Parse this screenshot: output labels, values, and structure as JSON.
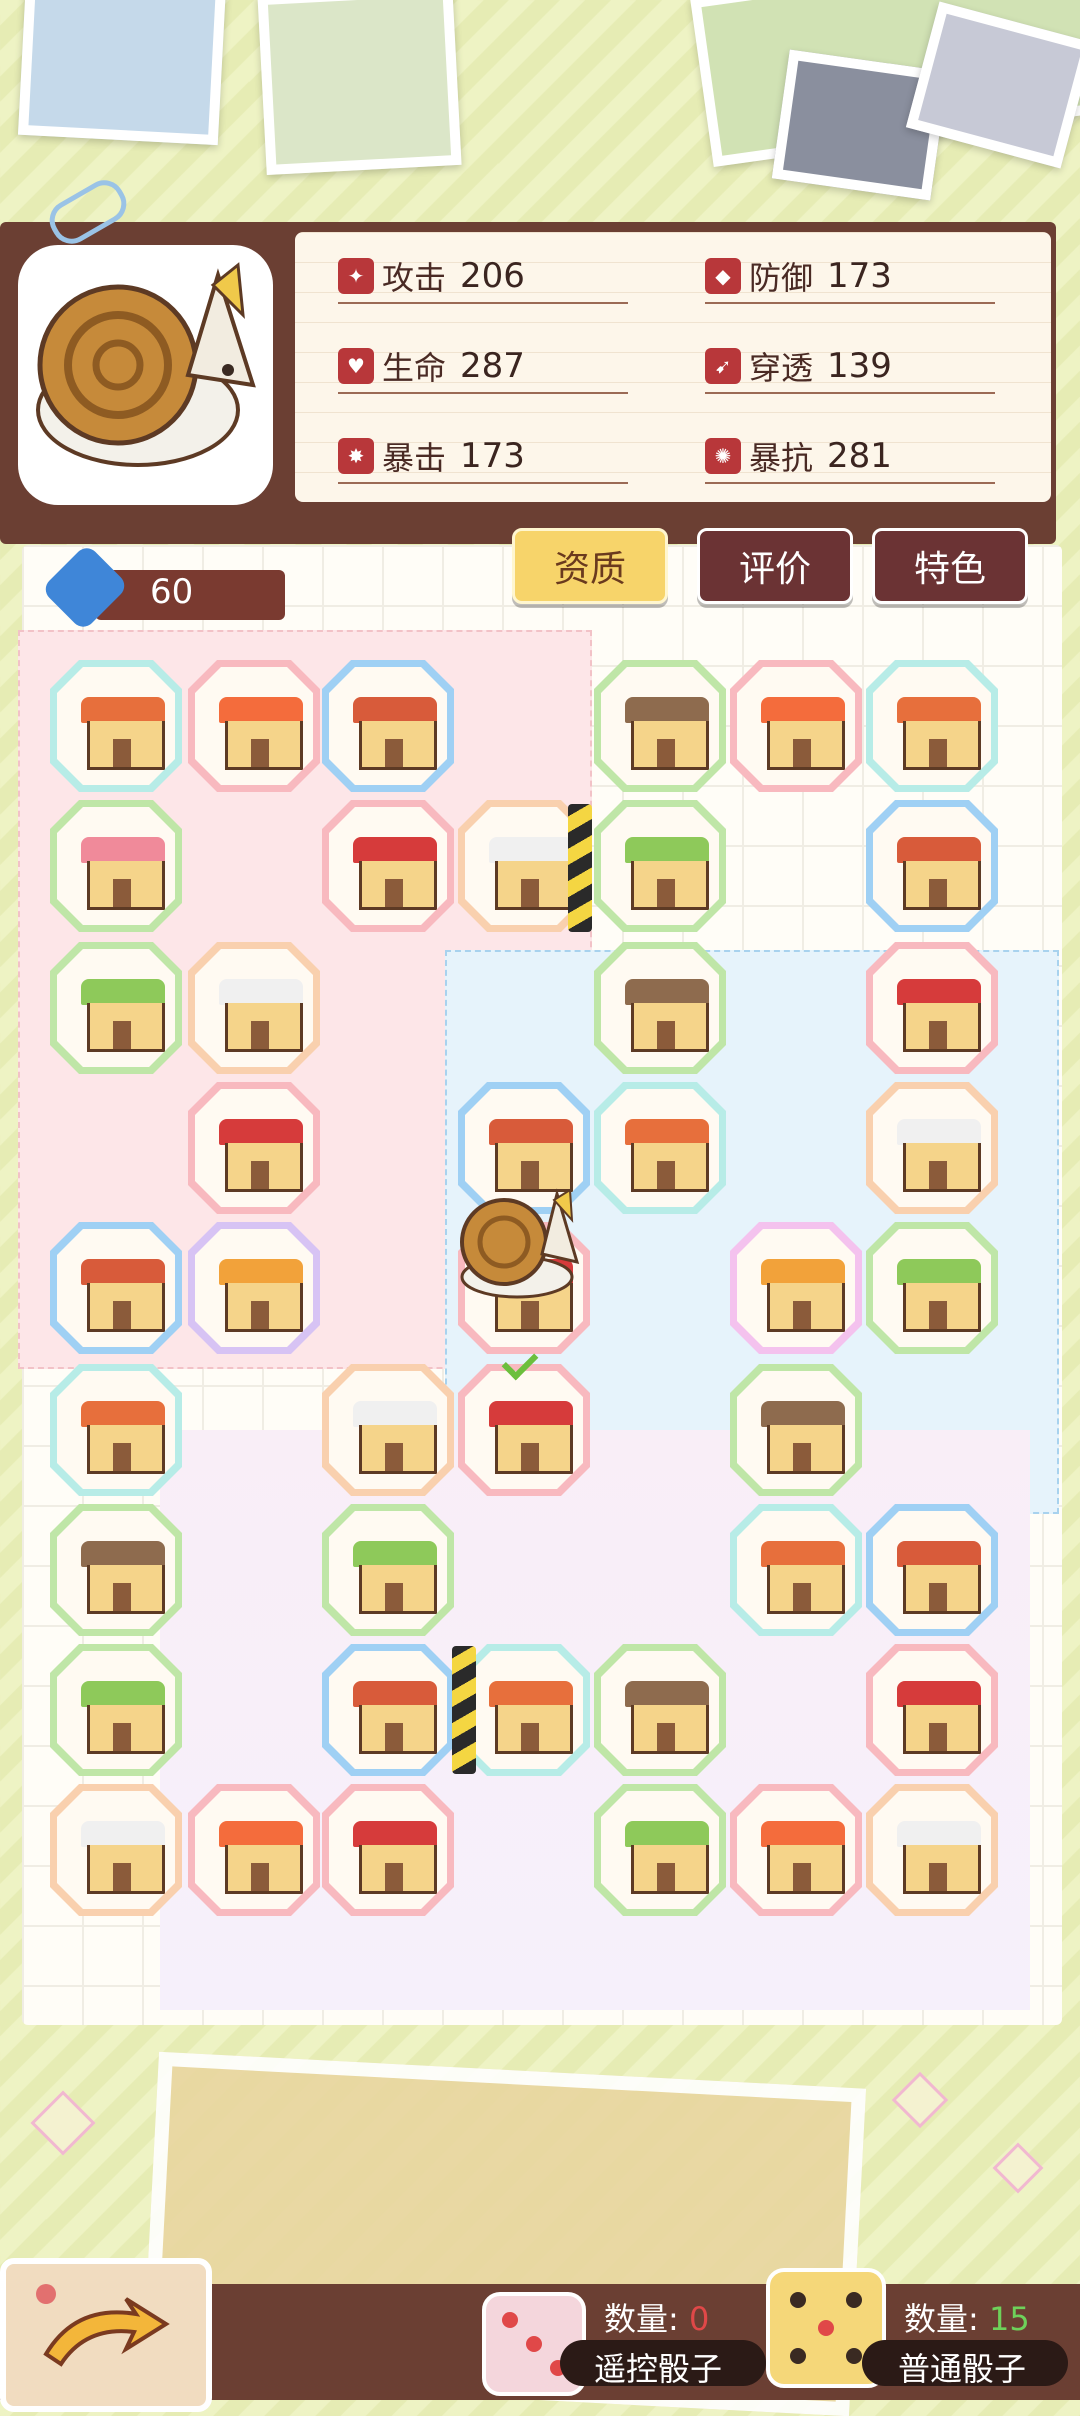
{
  "stats": [
    {
      "name": "攻击",
      "value": "206",
      "icon": "attack-icon"
    },
    {
      "name": "防御",
      "value": "173",
      "icon": "defense-icon"
    },
    {
      "name": "生命",
      "value": "287",
      "icon": "health-icon"
    },
    {
      "name": "穿透",
      "value": "139",
      "icon": "penetration-icon"
    },
    {
      "name": "暴击",
      "value": "173",
      "icon": "crit-icon"
    },
    {
      "name": "暴抗",
      "value": "281",
      "icon": "crit-resist-icon"
    }
  ],
  "tabs": [
    {
      "label": "资质",
      "active": true
    },
    {
      "label": "评价",
      "active": false
    },
    {
      "label": "特色",
      "active": false
    }
  ],
  "energy": {
    "value": "60",
    "icon": "energy-drop-icon"
  },
  "board": {
    "tile_types": [
      "bakery",
      "cafe",
      "house",
      "hotel",
      "bookstore",
      "market",
      "volcano-book",
      "traffic-light"
    ],
    "colors": {
      "blue": "#9fd0f4",
      "green": "#bfe6a7",
      "pink": "#f8b9bf",
      "orange": "#f9d0ae",
      "teal": "#b7ece7",
      "purple": "#d7c3f4"
    }
  },
  "dice": {
    "remote": {
      "count_label": "数量: ",
      "count": "0",
      "name": "遥控骰子",
      "count_color": "#e04848"
    },
    "normal": {
      "count_label": "数量: ",
      "count": "15",
      "name": "普通骰子",
      "count_color": "#6ed15a"
    }
  }
}
